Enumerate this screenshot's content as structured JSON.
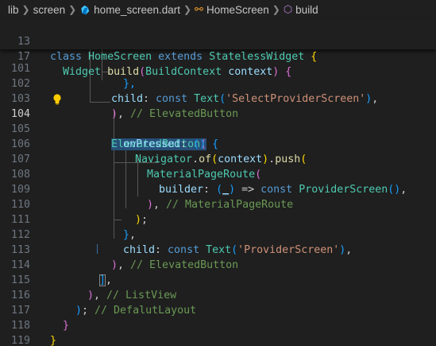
{
  "breadcrumb": {
    "items": [
      "lib",
      "screen",
      "home_screen.dart",
      "HomeScreen",
      "build"
    ]
  },
  "sticky": [
    {
      "num": "13",
      "text": "class HomeScreen extends StatelessWidget {"
    },
    {
      "num": "17",
      "text": "Widget build(BuildContext context) {"
    }
  ],
  "lines": [
    {
      "num": "101",
      "tokens": [
        "},"
      ]
    },
    {
      "num": "102",
      "tokens": [
        "child",
        ": ",
        "const",
        " ",
        "Text",
        "(",
        "'SelectProviderScreen'",
        "),"
      ]
    },
    {
      "num": "103",
      "tokens": [
        "), ",
        "// ElevatedButton"
      ]
    },
    {
      "num": "104",
      "tokens": [
        "ElevatedButton",
        "("
      ]
    },
    {
      "num": "105",
      "tokens": [
        "onPressed",
        ": () {"
      ]
    },
    {
      "num": "106",
      "tokens": [
        "Navigator",
        ".",
        "of",
        "(",
        "context",
        ").",
        "push",
        "("
      ]
    },
    {
      "num": "107",
      "tokens": [
        "MaterialPageRoute",
        "("
      ]
    },
    {
      "num": "108",
      "tokens": [
        "builder",
        ": (",
        "_",
        ") => ",
        "const",
        " ",
        "ProviderScreen",
        "(),"
      ]
    },
    {
      "num": "109",
      "tokens": [
        "), ",
        "// MaterialPageRoute"
      ]
    },
    {
      "num": "110",
      "tokens": [
        ");"
      ]
    },
    {
      "num": "111",
      "tokens": [
        "},"
      ]
    },
    {
      "num": "112",
      "tokens": [
        "child",
        ": ",
        "const",
        " ",
        "Text",
        "(",
        "'ProviderScreen'",
        "),"
      ]
    },
    {
      "num": "113",
      "tokens": [
        "), ",
        "// ElevatedButton"
      ]
    },
    {
      "num": "114",
      "tokens": [
        "],"
      ]
    },
    {
      "num": "115",
      "tokens": [
        "), ",
        "// ListView"
      ]
    },
    {
      "num": "116",
      "tokens": [
        "); ",
        "// DefalutLayout"
      ]
    },
    {
      "num": "117",
      "tokens": [
        "}"
      ]
    },
    {
      "num": "118",
      "tokens": [
        "}"
      ]
    },
    {
      "num": "119",
      "tokens": []
    }
  ],
  "active_line": "104",
  "icons": {
    "breadcrumb_separator": "chevron-right-icon",
    "file": "dart-file-icon",
    "class": "class-symbol-icon",
    "method": "method-symbol-icon",
    "gutter": "lightbulb-icon"
  },
  "colors": {
    "background": "#1f1f1f",
    "keyword": "#569cd6",
    "type": "#4ec9b0",
    "function": "#dcdcaa",
    "property": "#9cdcfe",
    "string": "#ce9178",
    "comment": "#6a9955",
    "bracket_gold": "#ffd700",
    "bracket_purple": "#da70d6",
    "bracket_blue": "#179fff",
    "line_number": "#6e7681"
  }
}
